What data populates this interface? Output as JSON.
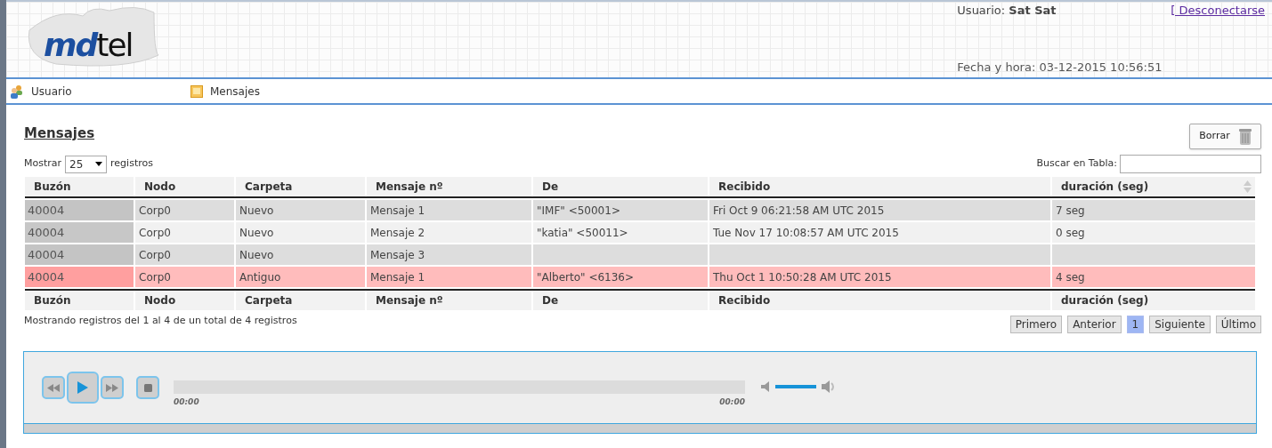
{
  "header": {
    "logo": {
      "brand_a": "md",
      "brand_b": "tel"
    },
    "user_label": "Usuario:",
    "user_name": "Sat Sat",
    "logout": "[ Desconectarse",
    "datetime": "Fecha y hora: 03-12-2015 10:56:51"
  },
  "nav": [
    {
      "label": "Usuario",
      "kind": "users"
    },
    {
      "label": "Mensajes",
      "kind": "messages"
    }
  ],
  "page_title": "Mensajes",
  "delete_button": "Borrar",
  "length_menu": {
    "before": "Mostrar",
    "value": "25",
    "after": "registros"
  },
  "search": {
    "label": "Buscar en Tabla:"
  },
  "table": {
    "columns": [
      "Buzón",
      "Nodo",
      "Carpeta",
      "Mensaje nº",
      "De",
      "Recibido",
      "duración (seg)"
    ],
    "rows": [
      {
        "kind": "new",
        "cells": [
          "40004",
          "Corp0",
          "Nuevo",
          "Mensaje 1",
          "\"IMF\" <50001>",
          "Fri Oct 9 06:21:58 AM UTC 2015",
          "7 seg"
        ]
      },
      {
        "kind": "new",
        "cells": [
          "40004",
          "Corp0",
          "Nuevo",
          "Mensaje 2",
          "\"katia\" <50011>",
          "Tue Nov 17 10:08:57 AM UTC 2015",
          "0 seg"
        ]
      },
      {
        "kind": "new",
        "cells": [
          "40004",
          "Corp0",
          "Nuevo",
          "Mensaje 3",
          "",
          "",
          ""
        ]
      },
      {
        "kind": "old",
        "cells": [
          "40004",
          "Corp0",
          "Antiguo",
          "Mensaje 1",
          "\"Alberto\" <6136>",
          "Thu Oct 1 10:50:28 AM UTC 2015",
          "4 seg"
        ]
      }
    ],
    "footer_columns": [
      "Buzón",
      "Nodo",
      "Carpeta",
      "Mensaje nº",
      "De",
      "Recibido",
      "duración (seg)"
    ]
  },
  "info": "Mostrando registros del 1 al 4 de un total de 4 registros",
  "pagination": [
    {
      "label": "Primero",
      "selected": false
    },
    {
      "label": "Anterior",
      "selected": false
    },
    {
      "label": "1",
      "selected": true
    },
    {
      "label": "Siguiente",
      "selected": false
    },
    {
      "label": "Último",
      "selected": false
    }
  ],
  "player": {
    "current_time": "00:00",
    "duration": "00:00",
    "volume": {
      "level": 1
    }
  }
}
